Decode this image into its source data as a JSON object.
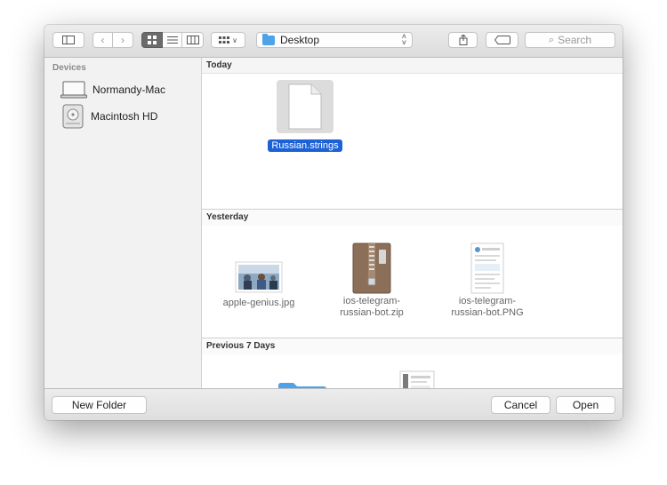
{
  "toolbar": {
    "location": "Desktop",
    "search_placeholder": "Search"
  },
  "sidebar": {
    "header": "Devices",
    "items": [
      {
        "label": "Normandy-Mac",
        "icon": "laptop-icon"
      },
      {
        "label": "Macintosh HD",
        "icon": "hard-drive-icon"
      }
    ]
  },
  "sections": [
    {
      "title": "Today"
    },
    {
      "title": "Yesterday"
    },
    {
      "title": "Previous 7 Days"
    }
  ],
  "files": {
    "today": [
      {
        "name": "Russian.strings",
        "selected": true
      }
    ],
    "yesterday": [
      {
        "name": "apple-genius.jpg"
      },
      {
        "line1": "ios-telegram-",
        "line2": "russian-bot.zip"
      },
      {
        "line1": "ios-telegram-",
        "line2": "russian-bot.PNG"
      }
    ]
  },
  "buttons": {
    "new_folder": "New Folder",
    "cancel": "Cancel",
    "open": "Open"
  },
  "colors": {
    "selection": "#1c62d6",
    "folder": "#4da2ea"
  }
}
